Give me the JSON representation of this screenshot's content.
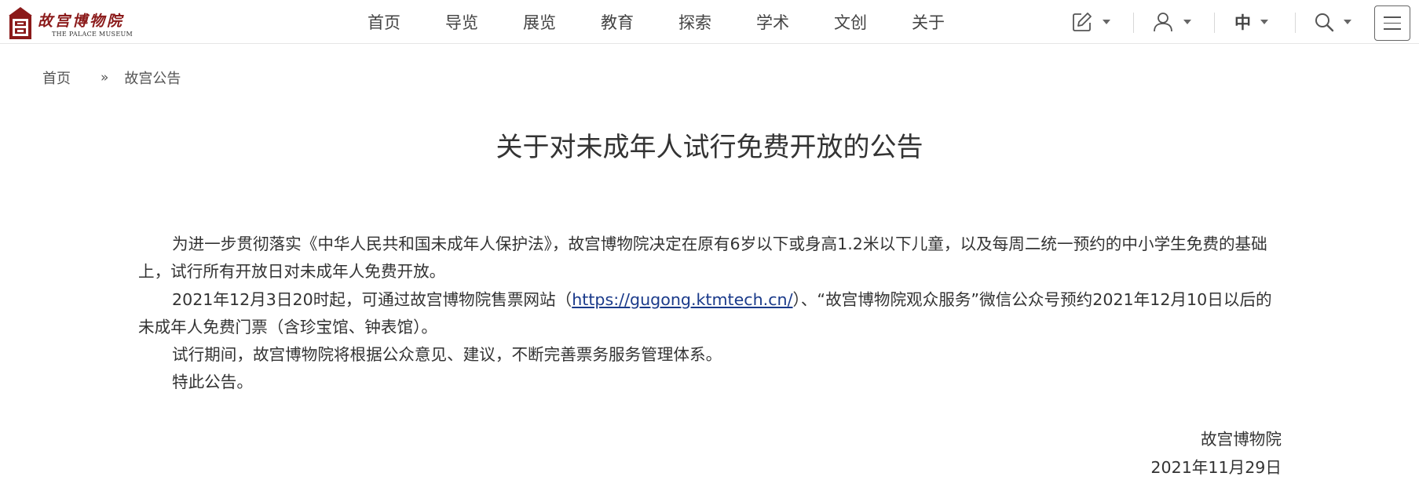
{
  "logo": {
    "cn": "故宫博物院",
    "en": "THE PALACE MUSEUM"
  },
  "nav": {
    "items": [
      "首页",
      "导览",
      "展览",
      "教育",
      "探索",
      "学术",
      "文创",
      "关于"
    ]
  },
  "toolbar": {
    "edit_icon": "pencil-edit-icon",
    "user_icon": "user-icon",
    "language": "中",
    "search_icon": "search-icon",
    "menu_icon": "hamburger-menu-icon"
  },
  "breadcrumb": {
    "home": "首页",
    "separator": "»",
    "current": "故宫公告"
  },
  "article": {
    "title": "关于对未成年人试行免费开放的公告",
    "p1": "为进一步贯彻落实《中华人民共和国未成年人保护法》，故宫博物院决定在原有6岁以下或身高1.2米以下儿童，以及每周二统一预约的中小学生免费的基础上，试行所有开放日对未成年人免费开放。",
    "p2_before": "2021年12月3日20时起，可通过故宫博物院售票网站（",
    "p2_link": "https://gugong.ktmtech.cn/",
    "p2_after": "）、“故宫博物院观众服务”微信公众号预约2021年12月10日以后的未成年人免费门票（含珍宝馆、钟表馆）。",
    "p3": "试行期间，故宫博物院将根据公众意见、建议，不断完善票务服务管理体系。",
    "p4": "特此公告。",
    "signature": "故宫博物院",
    "date": "2021年11月29日"
  },
  "colors": {
    "brand_red": "#8b1a1a",
    "link": "#1a3a8a",
    "text": "#333333"
  }
}
